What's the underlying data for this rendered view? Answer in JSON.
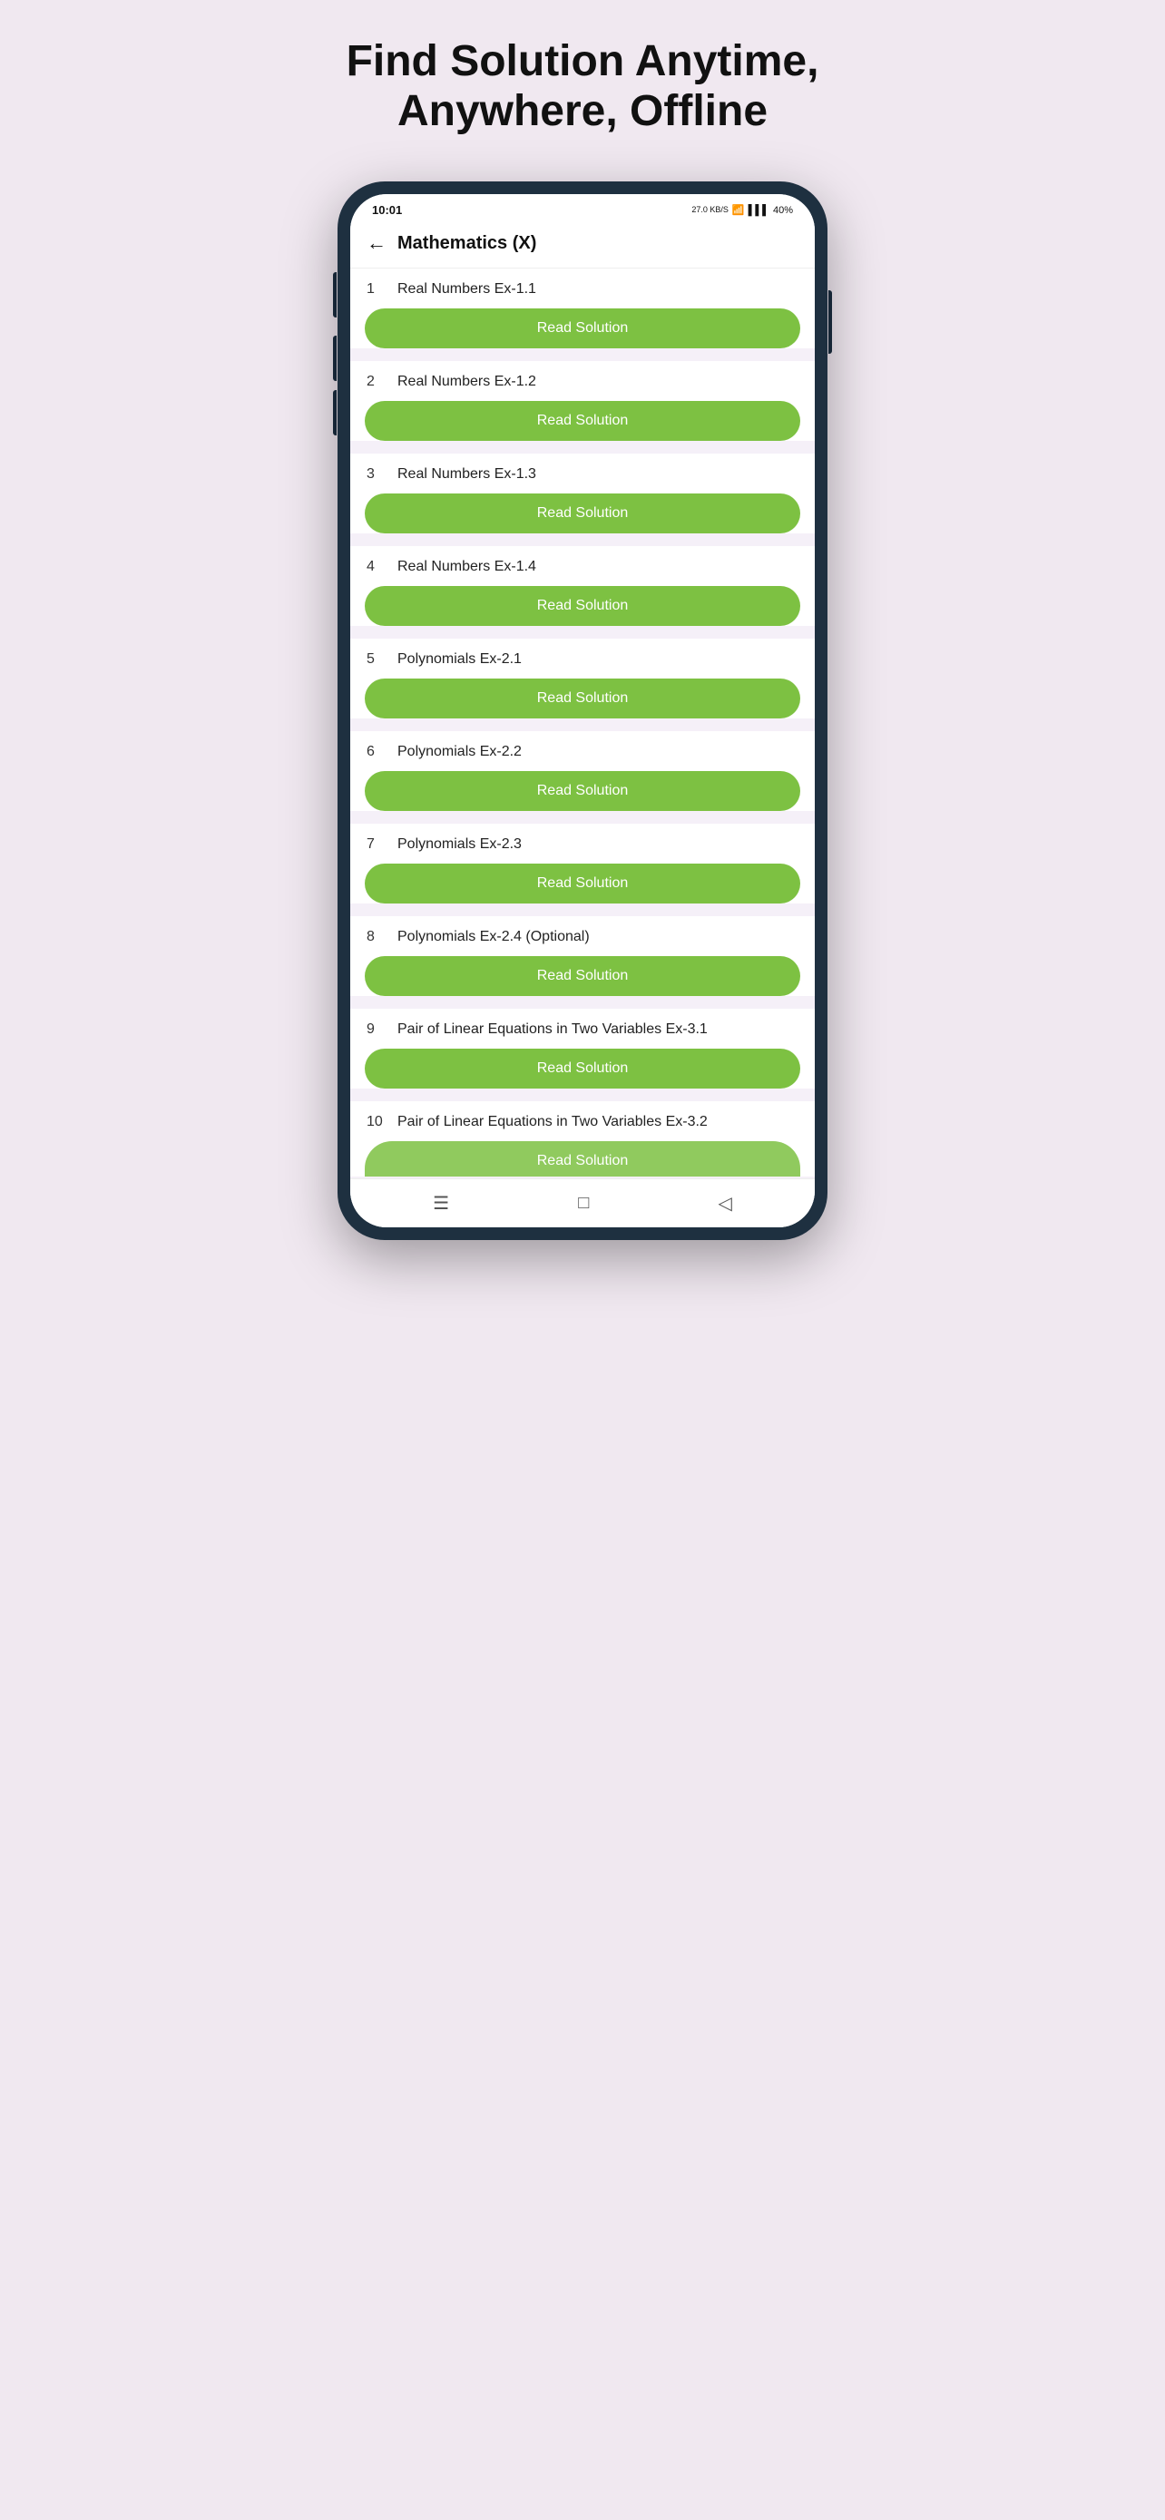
{
  "hero": {
    "title": "Find Solution Anytime, Anywhere, Offline"
  },
  "phone": {
    "status": {
      "time": "10:01",
      "data_speed": "27.0\nKB/S",
      "wifi_icon": "wifi",
      "signal_icon": "signal",
      "battery": "40%"
    },
    "nav": {
      "back_icon": "←",
      "title": "Mathematics (X)"
    },
    "items": [
      {
        "number": "1",
        "label": "Real Numbers Ex-1.1",
        "btn": "Read Solution"
      },
      {
        "number": "2",
        "label": "Real Numbers Ex-1.2",
        "btn": "Read Solution"
      },
      {
        "number": "3",
        "label": "Real Numbers Ex-1.3",
        "btn": "Read Solution"
      },
      {
        "number": "4",
        "label": "Real Numbers Ex-1.4",
        "btn": "Read Solution"
      },
      {
        "number": "5",
        "label": "Polynomials Ex-2.1",
        "btn": "Read Solution"
      },
      {
        "number": "6",
        "label": "Polynomials Ex-2.2",
        "btn": "Read Solution"
      },
      {
        "number": "7",
        "label": "Polynomials Ex-2.3",
        "btn": "Read Solution"
      },
      {
        "number": "8",
        "label": "Polynomials Ex-2.4 (Optional)",
        "btn": "Read Solution"
      },
      {
        "number": "9",
        "label": "Pair of Linear Equations in Two Variables Ex-3.1",
        "btn": "Read Solution"
      },
      {
        "number": "10",
        "label": "Pair of Linear Equations in Two Variables Ex-3.2",
        "btn": "Read Solution"
      }
    ],
    "bottom_nav": {
      "menu_icon": "☰",
      "home_icon": "□",
      "back_icon": "◁"
    }
  }
}
